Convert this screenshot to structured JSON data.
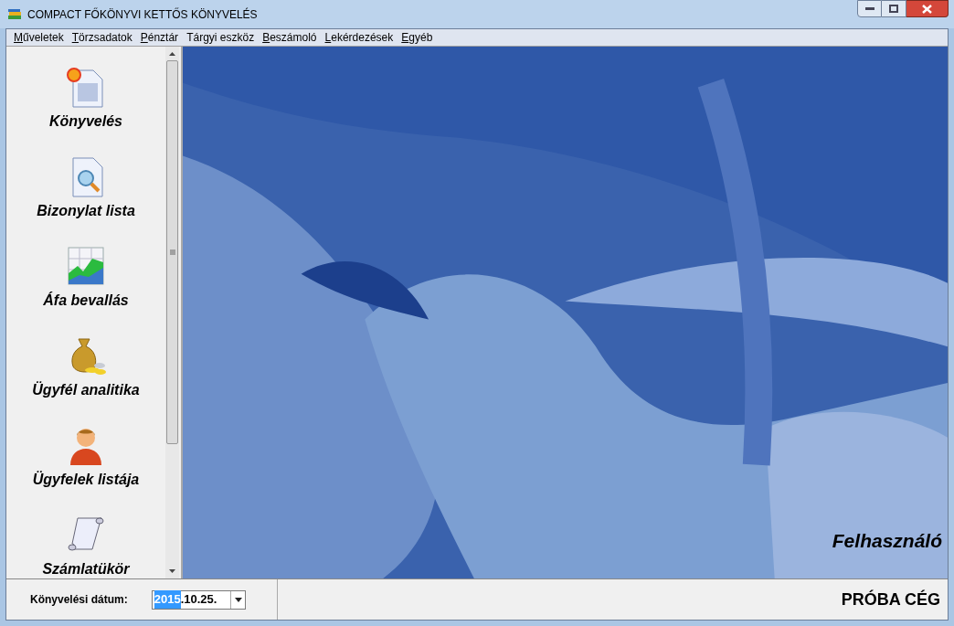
{
  "window": {
    "title": "COMPACT FŐKÖNYVI KETTŐS KÖNYVELÉS"
  },
  "menu": [
    {
      "access_key": "M",
      "label_after": "űveletek"
    },
    {
      "access_key": "T",
      "label_after": "örzsadatok"
    },
    {
      "access_key": "P",
      "label_after": "énztár"
    },
    {
      "label_before": "Tár",
      "access_key": "g",
      "label_after": "yi eszköz"
    },
    {
      "access_key": "B",
      "label_after": "eszámoló"
    },
    {
      "access_key": "L",
      "label_after": "ekérdezések"
    },
    {
      "access_key": "E",
      "label_after": "gyéb"
    }
  ],
  "sidebar": {
    "items": [
      {
        "kind": "document",
        "label": "Könyvelés"
      },
      {
        "kind": "search",
        "label": "Bizonylat lista"
      },
      {
        "kind": "chart",
        "label": "Áfa bevallás"
      },
      {
        "kind": "money",
        "label": "Ügyfél analitika"
      },
      {
        "kind": "person",
        "label": "Ügyfelek listája"
      },
      {
        "kind": "scroll",
        "label": "Számlatükör"
      }
    ]
  },
  "main": {
    "user_label": "Felhasználó"
  },
  "footer": {
    "date_label": "Könyvelési dátum:",
    "date_field": {
      "segments": [
        {
          "text": "2015",
          "selected": true
        },
        {
          "text": ".10.25.",
          "selected": false
        }
      ]
    },
    "company": "PRÓBA CÉG"
  }
}
